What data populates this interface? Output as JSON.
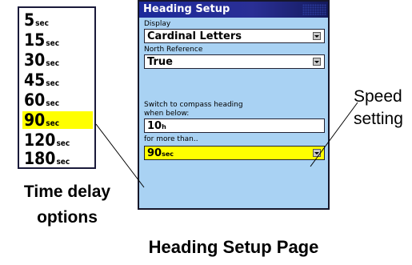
{
  "delay_options": {
    "items": [
      {
        "value": "5",
        "unit": "sec",
        "selected": false
      },
      {
        "value": "15",
        "unit": "sec",
        "selected": false
      },
      {
        "value": "30",
        "unit": "sec",
        "selected": false
      },
      {
        "value": "45",
        "unit": "sec",
        "selected": false
      },
      {
        "value": "60",
        "unit": "sec",
        "selected": false
      },
      {
        "value": "90",
        "unit": "sec",
        "selected": true
      },
      {
        "value": "120",
        "unit": "sec",
        "selected": false
      },
      {
        "value": "180",
        "unit": "sec",
        "selected": false
      }
    ],
    "caption_line1": "Time delay",
    "caption_line2": "options"
  },
  "window": {
    "title": "Heading Setup",
    "display": {
      "label": "Display",
      "value": "Cardinal Letters"
    },
    "north_reference": {
      "label": "North Reference",
      "value": "True"
    },
    "switch": {
      "label_line1": "Switch to compass heading",
      "label_line2": "when below:",
      "speed_value": "10",
      "speed_unit": "h"
    },
    "more_than": {
      "label": "for more than..",
      "value": "90",
      "unit": "sec"
    }
  },
  "annotations": {
    "speed_line1": "Speed",
    "speed_line2": "setting",
    "page_caption": "Heading Setup Page"
  },
  "colors": {
    "window_bg": "#a9d2f3",
    "title_bar": "#1c2a9a",
    "highlight": "#ffff00"
  }
}
